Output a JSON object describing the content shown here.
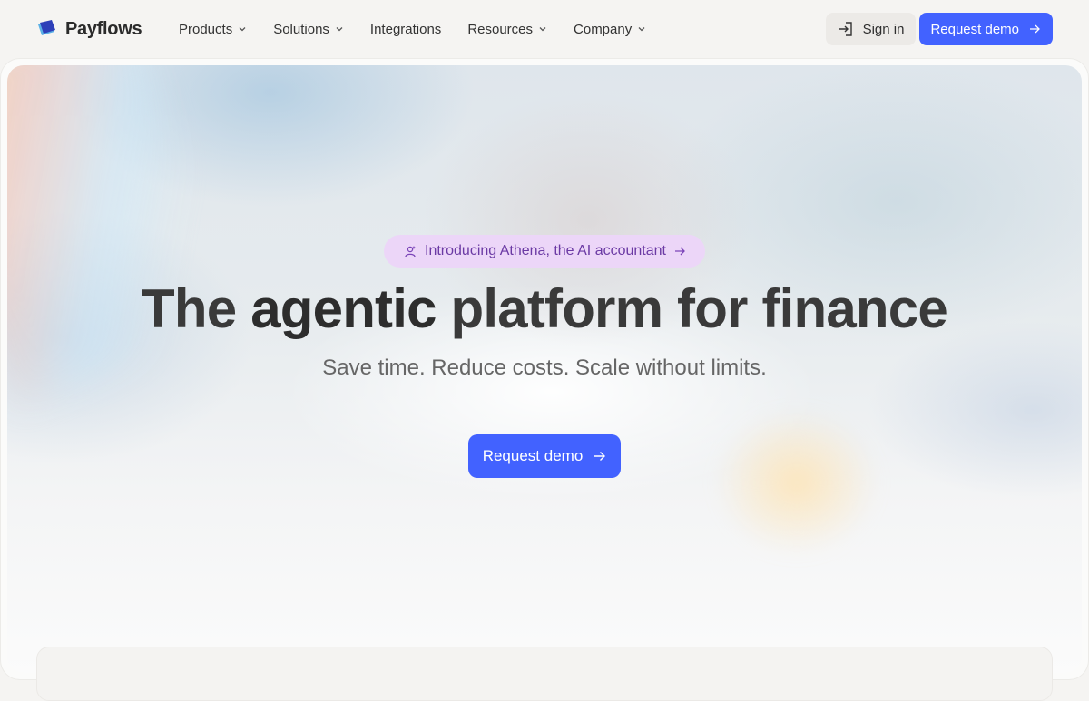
{
  "brand": {
    "name": "Payflows",
    "icon": "payflows-logo-icon"
  },
  "nav": {
    "items": [
      {
        "label": "Products",
        "has_dropdown": true
      },
      {
        "label": "Solutions",
        "has_dropdown": true
      },
      {
        "label": "Integrations",
        "has_dropdown": false
      },
      {
        "label": "Resources",
        "has_dropdown": true
      },
      {
        "label": "Company",
        "has_dropdown": true
      }
    ],
    "sign_in_label": "Sign in",
    "request_demo_label": "Request demo"
  },
  "hero": {
    "announcement": "Introducing Athena, the AI accountant",
    "headline_before": "The",
    "headline_bold": "agentic",
    "headline_after": "platform for finance",
    "subheadline": "Save time. Reduce costs. Scale without limits.",
    "cta_label": "Request demo"
  },
  "colors": {
    "primary": "#4262ff",
    "pill_bg": "#ecd6f8",
    "pill_text": "#6b3aa4"
  }
}
